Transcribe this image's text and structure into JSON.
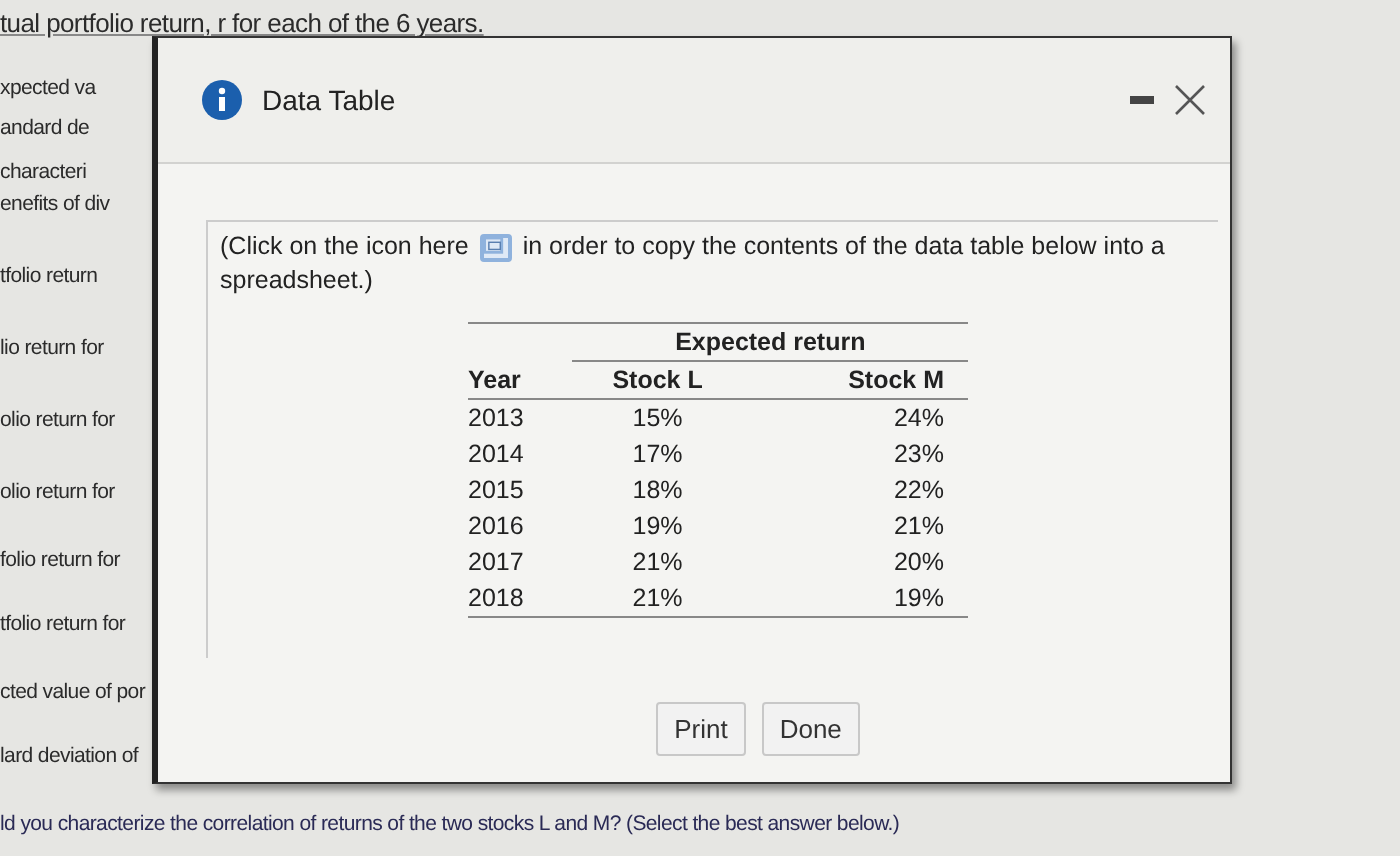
{
  "page": {
    "lines": [
      {
        "kind": "top",
        "text": "tual portfolio return, r   for each of the 6 years."
      },
      {
        "kind": "line",
        "text": "xpected va"
      },
      {
        "kind": "line",
        "text": "andard de"
      },
      {
        "kind": "line",
        "text": "characteri"
      },
      {
        "kind": "line",
        "text": "enefits of div"
      },
      {
        "kind": "line",
        "text": "tfolio return"
      },
      {
        "kind": "line",
        "text": "lio return for"
      },
      {
        "kind": "line",
        "text": "olio return for"
      },
      {
        "kind": "line",
        "text": "olio return for"
      },
      {
        "kind": "line",
        "text": "folio return for"
      },
      {
        "kind": "line",
        "text": "tfolio return for"
      },
      {
        "kind": "line",
        "text": "cted value of por"
      },
      {
        "kind": "line",
        "text": "lard deviation of"
      },
      {
        "kind": "line",
        "text": "ld you characterize the correlation of returns of the two stocks L and M?  (Select the best answer below.)"
      }
    ]
  },
  "dialog": {
    "title": "Data Table",
    "instruction_before": "(Click on the icon here",
    "instruction_after": "in order to copy the contents of the data table below into a spreadsheet.)",
    "table": {
      "group_header": "Expected return",
      "columns": [
        "Year",
        "Stock L",
        "Stock M"
      ],
      "rows": [
        [
          "2013",
          "15%",
          "24%"
        ],
        [
          "2014",
          "17%",
          "23%"
        ],
        [
          "2015",
          "18%",
          "22%"
        ],
        [
          "2016",
          "19%",
          "21%"
        ],
        [
          "2017",
          "21%",
          "20%"
        ],
        [
          "2018",
          "21%",
          "19%"
        ]
      ]
    },
    "buttons": [
      "Print",
      "Done"
    ]
  }
}
